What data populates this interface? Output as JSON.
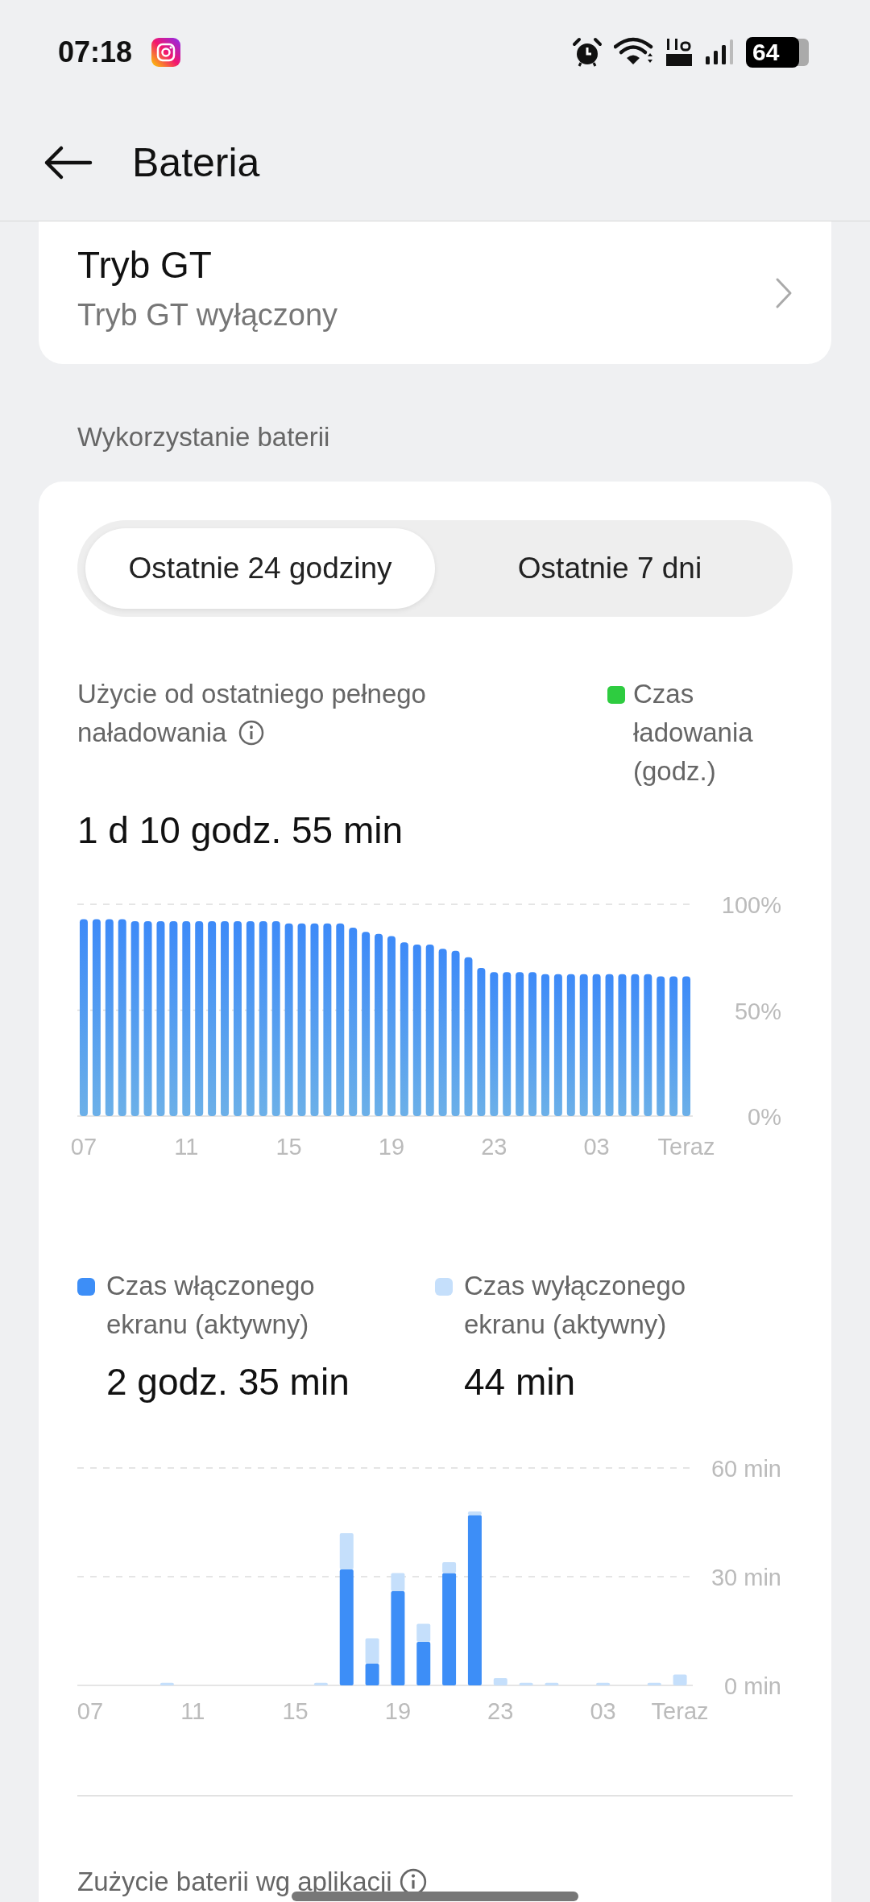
{
  "status_bar": {
    "time": "07:18",
    "battery": "64"
  },
  "header": {
    "title": "Bateria"
  },
  "gt_mode": {
    "title": "Tryb GT",
    "subtitle": "Tryb GT wyłączony"
  },
  "section_label": "Wykorzystanie baterii",
  "range_tabs": [
    {
      "label": "Ostatnie 24 godziny",
      "selected": true
    },
    {
      "label": "Ostatnie 7 dni",
      "selected": false
    }
  ],
  "usage": {
    "label": "Użycie od ostatniego pełnego naładowania",
    "legend": {
      "label": "Czas ładowania (godz.)",
      "color": "#2ecc40"
    },
    "duration": "1 d 10 godz. 55 min"
  },
  "battery_chart": {
    "chart_data": {
      "type": "bar",
      "categories": [
        "07",
        null,
        null,
        null,
        null,
        null,
        null,
        null,
        "11",
        null,
        null,
        null,
        null,
        null,
        null,
        null,
        "15",
        null,
        null,
        null,
        null,
        null,
        null,
        null,
        "19",
        null,
        null,
        null,
        null,
        null,
        null,
        null,
        "23",
        null,
        null,
        null,
        null,
        null,
        null,
        null,
        "03",
        null,
        null,
        null,
        null,
        null,
        null,
        "Teraz"
      ],
      "values": [
        93,
        93,
        93,
        93,
        92,
        92,
        92,
        92,
        92,
        92,
        92,
        92,
        92,
        92,
        92,
        92,
        91,
        91,
        91,
        91,
        91,
        89,
        87,
        86,
        85,
        82,
        81,
        81,
        79,
        78,
        75,
        70,
        68,
        68,
        68,
        68,
        67,
        67,
        67,
        67,
        67,
        67,
        67,
        67,
        67,
        66,
        66,
        66
      ],
      "ylim": [
        0,
        100
      ],
      "yticks": [
        {
          "value": 0,
          "label": "0%"
        },
        {
          "value": 50,
          "label": "50%"
        },
        {
          "value": 100,
          "label": "100%"
        }
      ]
    }
  },
  "screen_legend": [
    {
      "value": "2 godz. 35 min"
    },
    {
      "value": "44 min"
    }
  ],
  "screen_chart": {
    "chart_data": {
      "type": "bar",
      "stacked": true,
      "categories": [
        "07",
        null,
        null,
        null,
        "11",
        null,
        null,
        null,
        "15",
        null,
        null,
        null,
        "19",
        null,
        null,
        null,
        "23",
        null,
        null,
        null,
        "03",
        null,
        null,
        "Teraz"
      ],
      "series": [
        {
          "name": "Czas włączonego ekranu (aktywny)",
          "color": "#3d8ef7",
          "values": [
            0,
            0,
            0,
            0,
            0,
            0,
            0,
            0,
            0,
            0,
            32,
            6,
            26,
            12,
            31,
            47,
            0,
            0,
            0,
            0,
            0,
            0,
            0,
            0
          ]
        },
        {
          "name": "Czas wyłączonego ekranu (aktywny)",
          "color": "#c5dffb",
          "values": [
            0,
            0,
            0,
            0.7,
            0,
            0,
            0,
            0,
            0,
            0.7,
            10,
            7,
            5,
            5,
            3,
            1,
            2,
            0.7,
            0.7,
            0,
            0.7,
            0,
            0.7,
            3
          ]
        }
      ],
      "ylim": [
        0,
        60
      ],
      "yticks": [
        {
          "value": 0,
          "label": "0 min"
        },
        {
          "value": 30,
          "label": "30 min"
        },
        {
          "value": 60,
          "label": "60 min"
        }
      ]
    }
  },
  "app_usage": {
    "label": "Zużycie baterii wg aplikacji"
  }
}
